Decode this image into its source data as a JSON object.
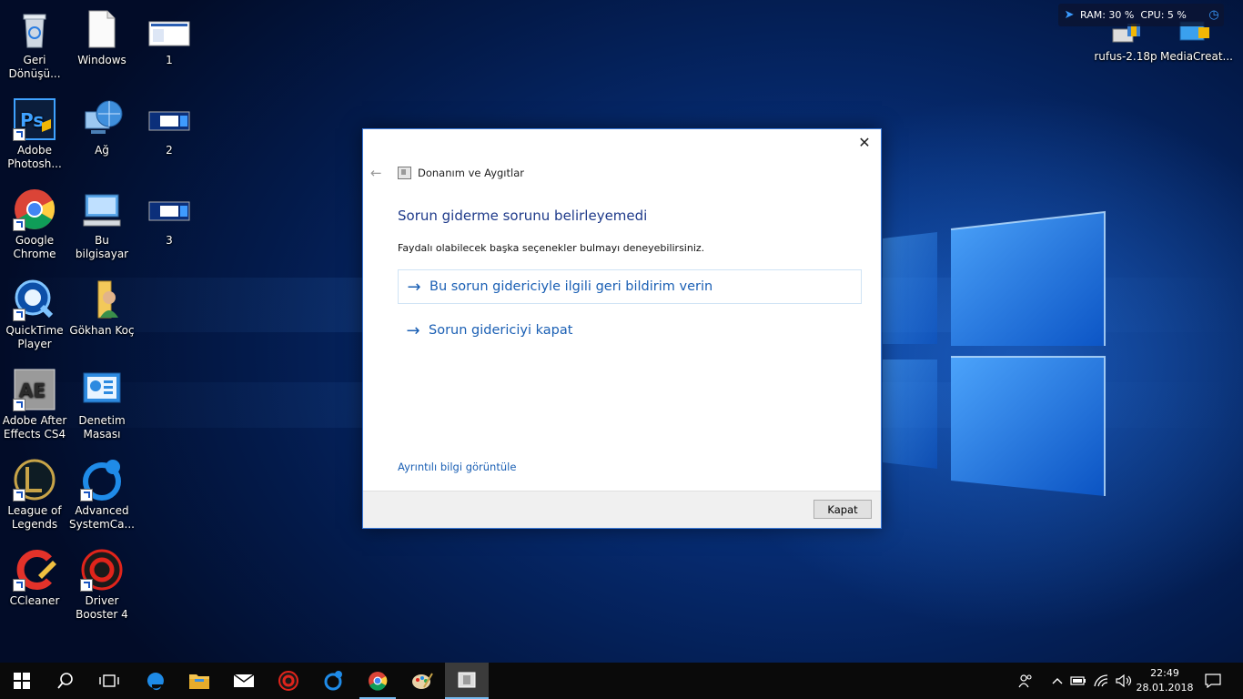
{
  "desktop": {
    "icons": [
      {
        "label": "Geri Dönüşü..."
      },
      {
        "label": "Windows"
      },
      {
        "label": "1"
      },
      {
        "label": "Adobe Photosh..."
      },
      {
        "label": "Ağ"
      },
      {
        "label": "2"
      },
      {
        "label": "Google Chrome"
      },
      {
        "label": "Bu bilgisayar"
      },
      {
        "label": "3"
      },
      {
        "label": "QuickTime Player"
      },
      {
        "label": "Gökhan Koç"
      },
      {
        "label": "Adobe After Effects CS4"
      },
      {
        "label": "Denetim Masası"
      },
      {
        "label": "League of Legends"
      },
      {
        "label": "Advanced SystemCa..."
      },
      {
        "label": "CCleaner"
      },
      {
        "label": "Driver Booster 4"
      },
      {
        "label": "rufus-2.18p"
      },
      {
        "label": "MediaCreat..."
      }
    ]
  },
  "widget": {
    "text": "RAM: 30 %  CPU: 5 %"
  },
  "dialog": {
    "breadcrumb": "Donanım ve Aygıtlar",
    "heading": "Sorun giderme sorunu belirleyemedi",
    "subtext": "Faydalı olabilecek başka seçenekler bulmayı deneyebilirsiniz.",
    "options": [
      {
        "label": "Bu sorun gidericiyle ilgili geri bildirim verin"
      },
      {
        "label": "Sorun gidericiyi kapat"
      }
    ],
    "details_link": "Ayrıntılı bilgi görüntüle",
    "close_button": "Kapat",
    "close_glyph": "✕"
  },
  "taskbar": {
    "time": "22:49",
    "date": "28.01.2018"
  },
  "colors": {
    "accent": "#1a5fb4",
    "heading": "#1e3a8a",
    "taskbar": "#0a0a0a"
  }
}
